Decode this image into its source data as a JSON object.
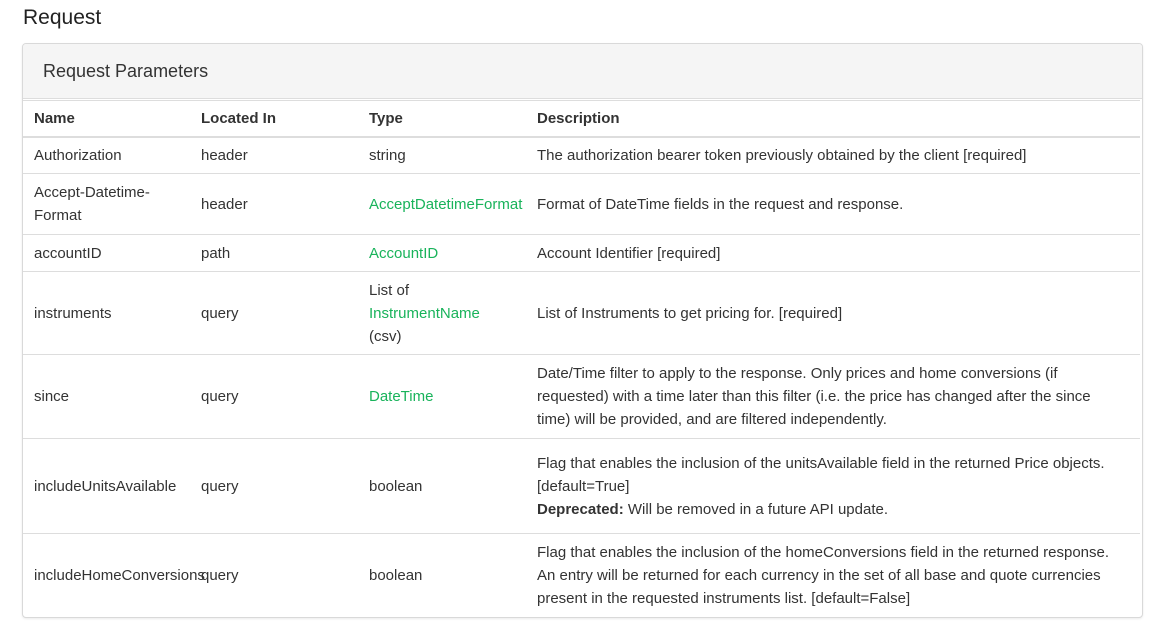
{
  "section_title": "Request",
  "panel_title": "Request Parameters",
  "columns": [
    "Name",
    "Located In",
    "Type",
    "Description"
  ],
  "rows": [
    {
      "name": "Authorization",
      "located_in": "header",
      "type_link": "",
      "type_plain": "string",
      "description": "The authorization bearer token previously obtained by the client [required]"
    },
    {
      "name": "Accept-Datetime-Format",
      "located_in": "header",
      "type_link": "AcceptDatetimeFormat",
      "description": "Format of DateTime fields in the request and response."
    },
    {
      "name": "accountID",
      "located_in": "path",
      "type_link": "AccountID",
      "description": "Account Identifier [required]"
    },
    {
      "name": "instruments",
      "located_in": "query",
      "type_prefix": "List of",
      "type_link": "InstrumentName",
      "type_suffix": "(csv)",
      "description": "List of Instruments to get pricing for. [required]"
    },
    {
      "name": "since",
      "located_in": "query",
      "type_link": "DateTime",
      "description": "Date/Time filter to apply to the response. Only prices and home conversions (if requested) with a time later than this filter (i.e. the price has changed after the since time) will be provided, and are filtered independently."
    },
    {
      "name": "includeUnitsAvailable",
      "located_in": "query",
      "type_plain": "boolean",
      "description": "Flag that enables the inclusion of the unitsAvailable field in the returned Price objects. [default=True]",
      "note_label": "Deprecated:",
      "note_text": " Will be removed in a future API update."
    },
    {
      "name": "includeHomeConversions",
      "located_in": "query",
      "type_plain": "boolean",
      "description": "Flag that enables the inclusion of the homeConversions field in the returned response. An entry will be returned for each currency in the set of all base and quote currencies present in the requested instruments list. [default=False]"
    }
  ]
}
